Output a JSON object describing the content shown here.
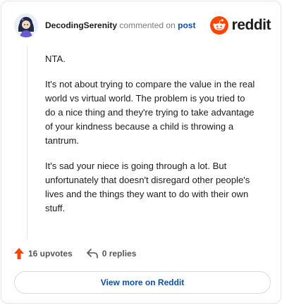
{
  "header": {
    "author": "DecodingSerenity",
    "action_text": "commented on",
    "post_link": "post",
    "brand_word": "reddit",
    "brand_color": "#ff4500"
  },
  "comment": {
    "paragraphs": [
      "NTA.",
      "It's not about trying to compare the value in the real world vs virtual world. The problem is you tried to do a nice thing and they're trying to take advantage of your kindness because a child is throwing a tantrum.",
      "It's sad your niece is going through a lot. But unfortunately that doesn't disregard other people's lives and the things they want to do with their own stuff."
    ]
  },
  "footer": {
    "upvotes": "16 upvotes",
    "upvote_icon": "upvote-arrow-icon",
    "upvote_color": "#ff4500",
    "replies": "0 replies",
    "reply_icon": "reply-arrow-icon"
  },
  "cta": {
    "label": "View more on Reddit",
    "color": "#0a4ea8"
  }
}
